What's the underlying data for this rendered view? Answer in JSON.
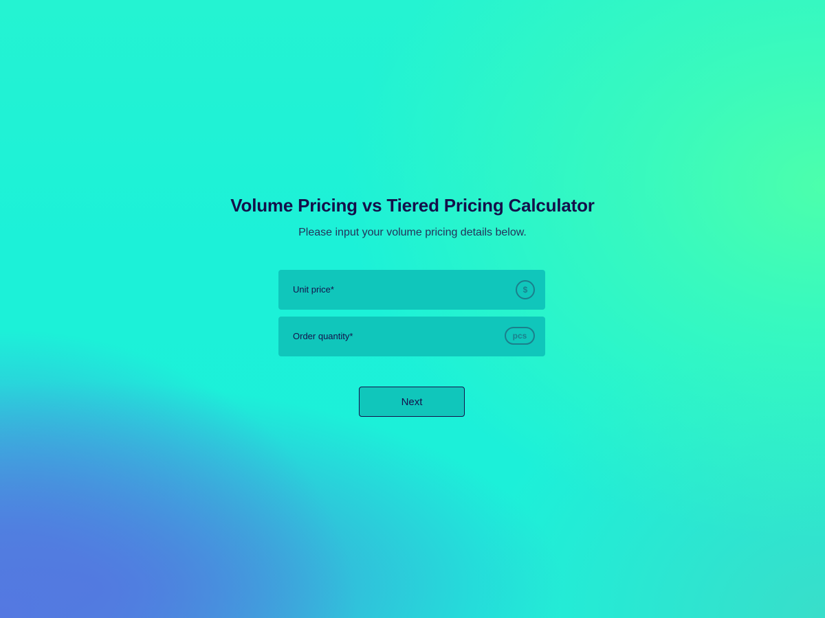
{
  "header": {
    "title": "Volume Pricing vs Tiered Pricing Calculator",
    "subtitle": "Please input your volume pricing details below."
  },
  "form": {
    "unit_price": {
      "label": "Unit price*",
      "value": "",
      "badge": "$",
      "badge_icon": "dollar-icon"
    },
    "order_quantity": {
      "label": "Order quantity*",
      "value": "",
      "badge": "pcs"
    }
  },
  "actions": {
    "next_label": "Next"
  },
  "colors": {
    "text": "#14104a",
    "field_bg": "#10c6bb",
    "badge": "#1b7f8c"
  }
}
